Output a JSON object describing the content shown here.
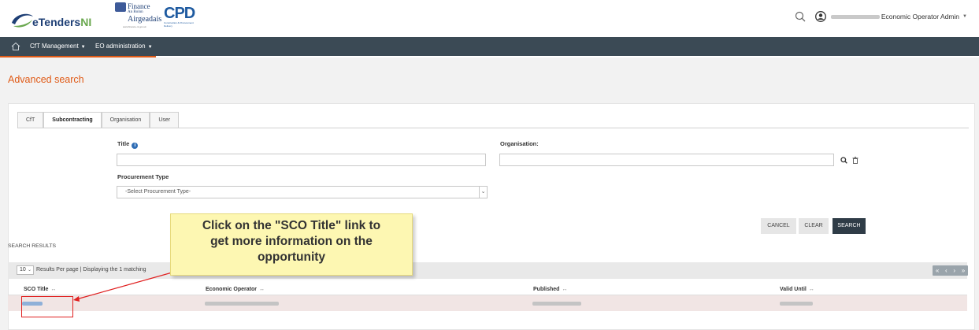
{
  "header": {
    "logo_etenders_text": "eTenders",
    "logo_etenders_suffix": "NI",
    "finance_line1": "Finance",
    "finance_line2": "An Roinn",
    "finance_line3": "Airgeadais",
    "finance_line4": "www.finance-ni.gov.uk",
    "cpd_text": "CPD",
    "cpd_sub": "Construction & Procurement Delivery",
    "user_role": "Economic Operator Admin"
  },
  "nav": {
    "items": [
      {
        "label": "CfT Management"
      },
      {
        "label": "EO administration"
      }
    ]
  },
  "page": {
    "title": "Advanced search"
  },
  "tabs": [
    {
      "label": "CfT",
      "active": false
    },
    {
      "label": "Subcontracting",
      "active": true
    },
    {
      "label": "Organisation",
      "active": false
    },
    {
      "label": "User",
      "active": false
    }
  ],
  "form": {
    "title_label": "Title",
    "title_value": "",
    "organisation_label": "Organisation:",
    "organisation_value": "",
    "procurement_type_label": "Procurement Type",
    "procurement_type_selected": "-Select Procurement Type-"
  },
  "buttons": {
    "cancel": "CANCEL",
    "clear": "CLEAR",
    "search": "SEARCH"
  },
  "results": {
    "heading": "SEARCH RESULTS",
    "per_page": "10",
    "per_page_text": "Results Per page | Displaying the 1 matching",
    "columns": [
      "SCO Title",
      "Economic Operator",
      "Published",
      "Valid Until"
    ],
    "sort_glyph": "↔"
  },
  "pager": {
    "first": "«",
    "prev": "‹",
    "next": "›",
    "last": "»"
  },
  "callout": {
    "text": "Click on the \"SCO Title\" link to get more information on the opportunity",
    "line1": "Click on the \"SCO Title\" link to",
    "line2": "get more information on the",
    "line3": "opportunity"
  },
  "colors": {
    "accent": "#e05a16",
    "nav_bg": "#3b4a55",
    "search_button": "#2f3c47",
    "callout_bg": "#fdf7b2",
    "highlight": "#e02020"
  }
}
